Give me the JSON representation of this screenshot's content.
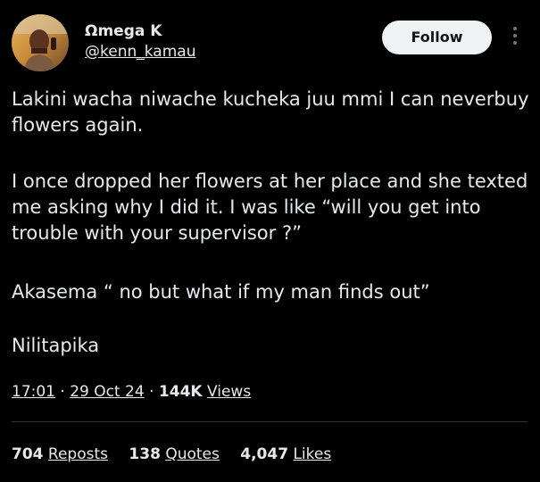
{
  "author": {
    "name": "Ωmega K",
    "handle": "@kenn_kamau"
  },
  "follow_button": {
    "label": "Follow"
  },
  "more_icon": "more-vertical-icon",
  "tweet": {
    "paragraphs": [
      "Lakini wacha niwache kucheka juu mmi I can neverbuy flowers again.",
      "I once dropped her flowers at her place and she texted me asking why I did it. I was like “will you get into trouble with your supervisor ?”",
      "Akasema “ no but what if my man finds out”",
      "Nilitapika"
    ]
  },
  "meta": {
    "time": "17:01",
    "separator": "·",
    "date": "29 Oct 24",
    "views_count": "144K",
    "views_label": "Views"
  },
  "stats": {
    "reposts_count": "704",
    "reposts_label": "Reposts",
    "quotes_count": "138",
    "quotes_label": "Quotes",
    "likes_count": "4,047",
    "likes_label": "Likes"
  },
  "colors": {
    "background": "#000000",
    "text": "#e7e9ea",
    "follow_button_bg": "#eff3f4",
    "follow_button_text": "#0f1419",
    "divider": "#2f3336"
  }
}
